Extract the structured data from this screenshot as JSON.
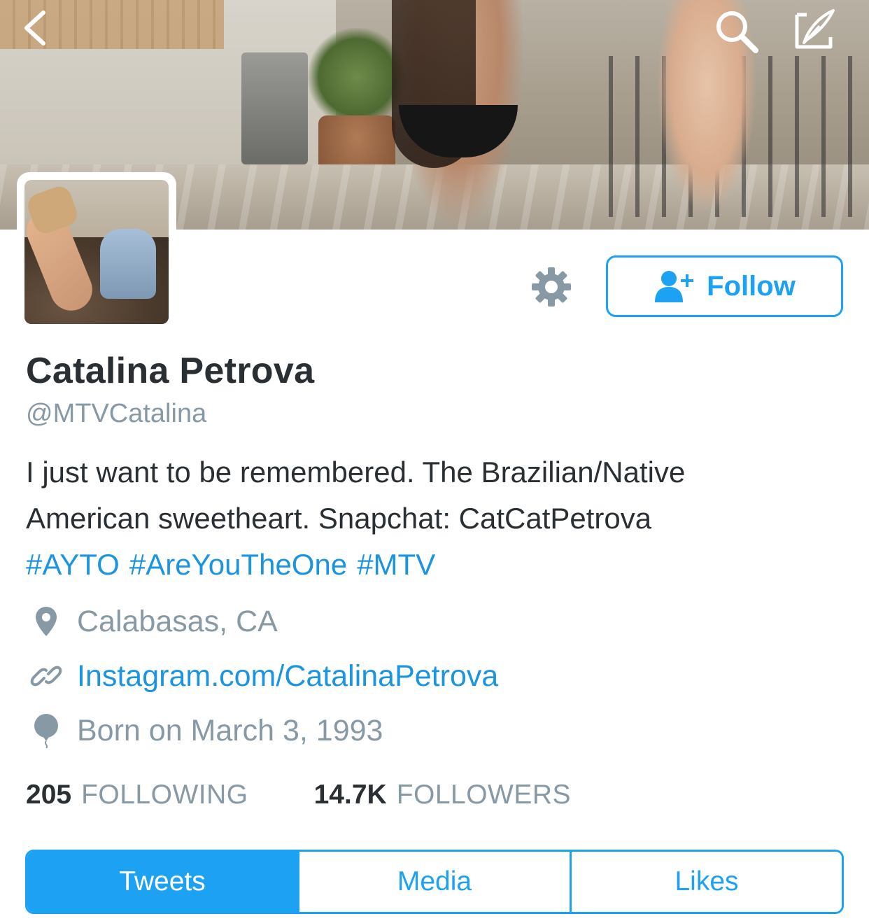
{
  "header": {
    "back_icon": "chevron-left-icon",
    "search_icon": "search-icon",
    "compose_icon": "compose-tweet-icon"
  },
  "profile": {
    "name": "Catalina Petrova",
    "handle": "@MTVCatalina",
    "bio_line1": "I just want to be remembered. The Brazilian/Native",
    "bio_line2": "American sweetheart. Snapchat: CatCatPetrova",
    "hashtags": [
      "#AYTO",
      "#AreYouTheOne",
      "#MTV"
    ],
    "location": "Calabasas, CA",
    "website": "Instagram.com/CatalinaPetrova",
    "birthday": "Born on March 3, 1993"
  },
  "actions": {
    "settings_icon": "gear-icon",
    "follow_icon": "add-user-icon",
    "follow_label": "Follow"
  },
  "stats": {
    "following_count": "205",
    "following_label": "FOLLOWING",
    "followers_count": "14.7K",
    "followers_label": "FOLLOWERS"
  },
  "tabs": [
    {
      "label": "Tweets",
      "active": true
    },
    {
      "label": "Media",
      "active": false
    },
    {
      "label": "Likes",
      "active": false
    }
  ],
  "colors": {
    "accent": "#1da1f2",
    "link": "#1b95e0",
    "text": "#292f33",
    "muted": "#8899a6"
  }
}
